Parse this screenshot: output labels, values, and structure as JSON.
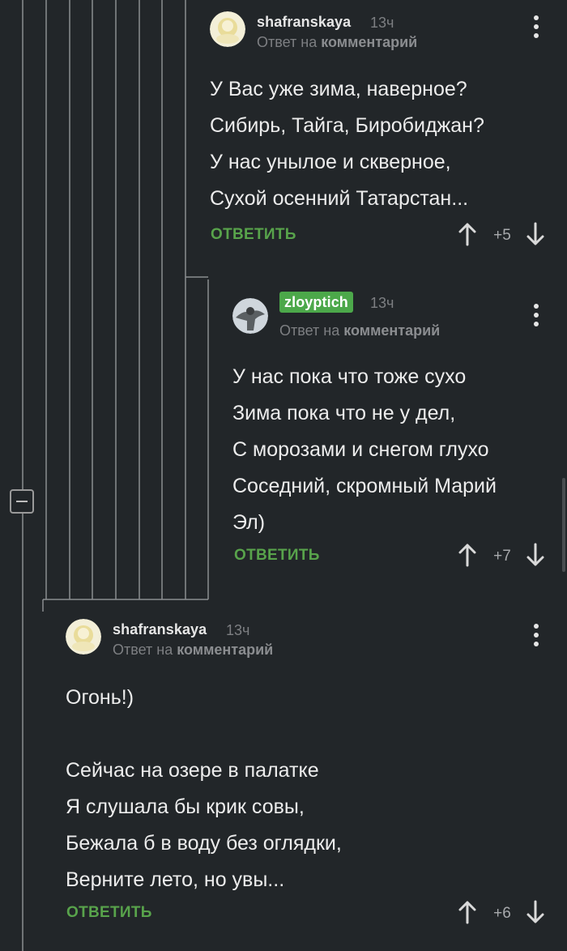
{
  "comments": [
    {
      "author": "shafranskaya",
      "time": "13ч",
      "reply_prefix": "Ответ на",
      "reply_link": "комментарий",
      "lines": [
        "У Вас уже зима, наверное?",
        "Сибирь, Тайга, Биробиджан?",
        "У нас унылое и скверное,",
        "Сухой осенний Татарстан..."
      ],
      "reply_label": "ОТВЕТИТЬ",
      "score": "+5"
    },
    {
      "author": "zloyptich",
      "time": "13ч",
      "reply_prefix": "Ответ на",
      "reply_link": "комментарий",
      "lines": [
        "У нас пока что тоже сухо",
        "Зима пока что не у дел,",
        "С морозами и снегом глухо",
        "Соседний, скромный Марий",
        "Эл)"
      ],
      "reply_label": "ОТВЕТИТЬ",
      "score": "+7"
    },
    {
      "author": "shafranskaya",
      "time": "13ч",
      "reply_prefix": "Ответ на",
      "reply_link": "комментарий",
      "lines": [
        "Огонь!)",
        "",
        "Сейчас на озере в палатке",
        "Я слушала бы крик совы,",
        "Бежала б в воду без оглядки,",
        "Верните лето, но увы..."
      ],
      "reply_label": "ОТВЕТИТЬ",
      "score": "+6"
    }
  ],
  "icons": {
    "upvote": "arrow-up-icon",
    "downvote": "arrow-down-icon",
    "menu": "more-vertical-icon",
    "collapse": "collapse-minus-icon"
  },
  "colors": {
    "background": "#222629",
    "accent_green": "#58a34b",
    "badge_green": "#4ca84a",
    "muted_text": "#7d7f82",
    "thread_line": "#8a8d90"
  }
}
